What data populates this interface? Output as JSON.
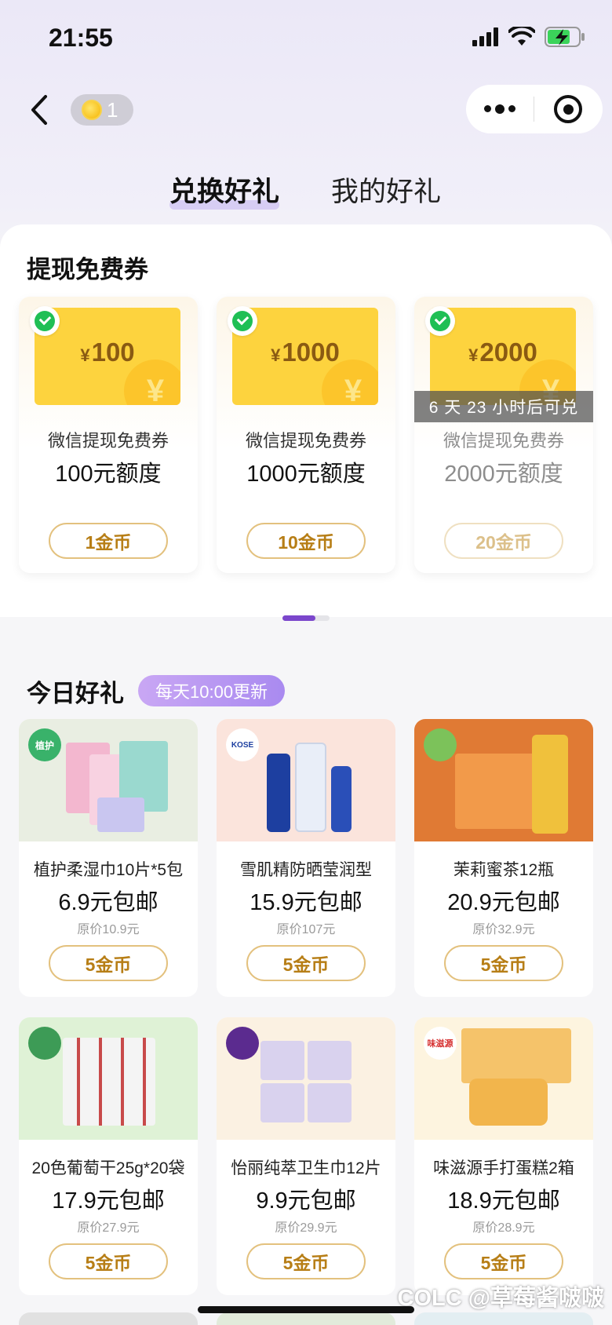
{
  "status_bar": {
    "time": "21:55"
  },
  "nav": {
    "coin_count": "1"
  },
  "tabs": [
    {
      "label": "兑换好礼",
      "active": true
    },
    {
      "label": "我的好礼",
      "active": false
    }
  ],
  "vouchers_section": {
    "title": "提现免费券",
    "cards": [
      {
        "currency": "¥",
        "amount": "100",
        "name": "微信提现免费券",
        "quota": "100元额度",
        "price": "1金币",
        "countdown": ""
      },
      {
        "currency": "¥",
        "amount": "1000",
        "name": "微信提现免费券",
        "quota": "1000元额度",
        "price": "10金币",
        "countdown": ""
      },
      {
        "currency": "¥",
        "amount": "2000",
        "name": "微信提现免费券",
        "quota": "2000元额度",
        "price": "20金币",
        "countdown": "6 天 23 小时后可兑"
      }
    ]
  },
  "today_section": {
    "title": "今日好礼",
    "tag": "每天10:00更新",
    "products": [
      {
        "name": "植护柔湿巾10片*5包",
        "price": "6.9元包邮",
        "original": "原价10.9元",
        "cost": "5金币",
        "brand": "植护"
      },
      {
        "name": "雪肌精防晒莹润型",
        "price": "15.9元包邮",
        "original": "原价107元",
        "cost": "5金币",
        "brand": "KOSE"
      },
      {
        "name": "茉莉蜜茶12瓶",
        "price": "20.9元包邮",
        "original": "原价32.9元",
        "cost": "5金币",
        "brand": ""
      },
      {
        "name": "20色葡萄干25g*20袋",
        "price": "17.9元包邮",
        "original": "原价27.9元",
        "cost": "5金币",
        "brand": ""
      },
      {
        "name": "怡丽纯萃卫生巾12片",
        "price": "9.9元包邮",
        "original": "原价29.9元",
        "cost": "5金币",
        "brand": ""
      },
      {
        "name": "味滋源手打蛋糕2箱",
        "price": "18.9元包邮",
        "original": "原价28.9元",
        "cost": "5金币",
        "brand": "味滋源"
      }
    ]
  },
  "watermark": "COLC @草莓酱啵啵",
  "colors": {
    "accent": "#7b46cc",
    "gold": "#b77e16",
    "voucher": "#fdd33e"
  },
  "icons": [
    "back-icon",
    "coin-icon",
    "more-icon",
    "target-icon",
    "wechat-icon",
    "signal-icon",
    "wifi-icon",
    "battery-icon"
  ]
}
